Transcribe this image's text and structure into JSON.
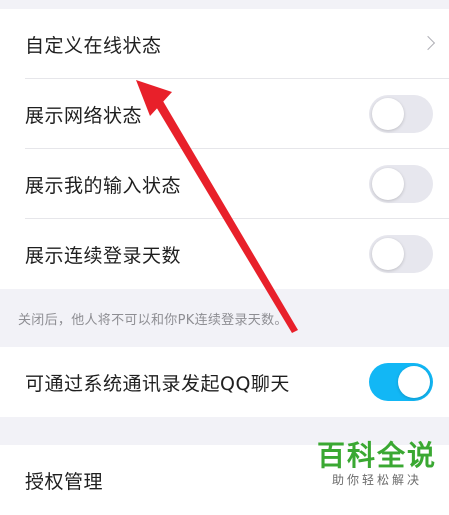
{
  "settings": {
    "group1": {
      "items": [
        {
          "label": "自定义在线状态",
          "type": "link"
        },
        {
          "label": "展示网络状态",
          "type": "toggle",
          "on": false
        },
        {
          "label": "展示我的输入状态",
          "type": "toggle",
          "on": false
        },
        {
          "label": "展示连续登录天数",
          "type": "toggle",
          "on": false
        }
      ],
      "note": "关闭后，他人将不可以和你PK连续登录天数。"
    },
    "group2": {
      "items": [
        {
          "label": "可通过系统通讯录发起QQ聊天",
          "type": "toggle",
          "on": true
        }
      ]
    },
    "group3": {
      "items": [
        {
          "label": "授权管理",
          "type": "link"
        }
      ]
    }
  },
  "icons": {
    "chevron": "chevron-right-icon",
    "arrow": "red-arrow-annotation"
  },
  "colors": {
    "toggle_on": "#12b7f5",
    "toggle_off": "#e7e7ee",
    "arrow": "#e8202a",
    "watermark": "#3aa832"
  },
  "watermark": {
    "title": "百科全说",
    "subtitle": "助你轻松解决"
  }
}
